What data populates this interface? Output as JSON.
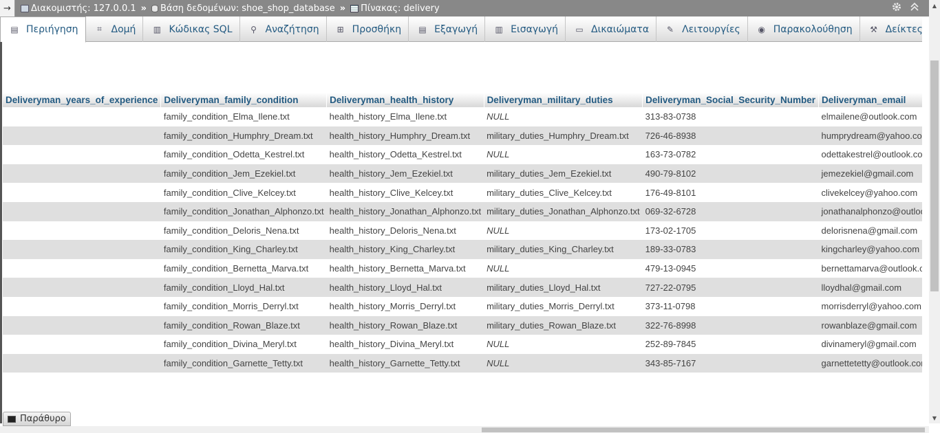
{
  "breadcrumb": {
    "back_glyph": "→",
    "server_label": "Διακομιστής: 127.0.0.1",
    "db_label": "Βάση δεδομένων: shoe_shop_database",
    "table_label": "Πίνακας: delivery",
    "separator": "»"
  },
  "tabs": [
    {
      "label": "Περιήγηση",
      "icon": "browse-icon",
      "glyph": "▤"
    },
    {
      "label": "Δομή",
      "icon": "structure-icon",
      "glyph": "⌗"
    },
    {
      "label": "Κώδικας SQL",
      "icon": "sql-icon",
      "glyph": "▥"
    },
    {
      "label": "Αναζήτηση",
      "icon": "search-icon",
      "glyph": "⚲"
    },
    {
      "label": "Προσθήκη",
      "icon": "insert-icon",
      "glyph": "⊞"
    },
    {
      "label": "Εξαγωγή",
      "icon": "export-icon",
      "glyph": "▤"
    },
    {
      "label": "Εισαγωγή",
      "icon": "import-icon",
      "glyph": "▥"
    },
    {
      "label": "Δικαιώματα",
      "icon": "privileges-icon",
      "glyph": "▭"
    },
    {
      "label": "Λειτουργίες",
      "icon": "operations-icon",
      "glyph": "✎"
    },
    {
      "label": "Παρακολούθηση",
      "icon": "tracking-icon",
      "glyph": "◉"
    },
    {
      "label": "Δείκτες",
      "icon": "triggers-icon",
      "glyph": "⚒"
    }
  ],
  "table": {
    "columns": [
      "Deliveryman_years_of_experience",
      "Deliveryman_family_condition",
      "Deliveryman_health_history",
      "Deliveryman_military_duties",
      "Deliveryman_Social_Security_Number",
      "Deliveryman_email"
    ],
    "rows": [
      [
        "",
        "family_condition_Elma_Ilene.txt",
        "health_history_Elma_Ilene.txt",
        "NULL",
        "313-83-0738",
        "elmailene@outlook.com"
      ],
      [
        "",
        "family_condition_Humphry_Dream.txt",
        "health_history_Humphry_Dream.txt",
        "military_duties_Humphry_Dream.txt",
        "726-46-8938",
        "humprydream@yahoo.com"
      ],
      [
        "",
        "family_condition_Odetta_Kestrel.txt",
        "health_history_Odetta_Kestrel.txt",
        "NULL",
        "163-73-0782",
        "odettakestrel@outlook.com"
      ],
      [
        "",
        "family_condition_Jem_Ezekiel.txt",
        "health_history_Jem_Ezekiel.txt",
        "military_duties_Jem_Ezekiel.txt",
        "490-79-8102",
        "jemezekiel@gmail.com"
      ],
      [
        "",
        "family_condition_Clive_Kelcey.txt",
        "health_history_Clive_Kelcey.txt",
        "military_duties_Clive_Kelcey.txt",
        "176-49-8101",
        "clivekelcey@yahoo.com"
      ],
      [
        "",
        "family_condition_Jonathan_Alphonzo.txt",
        "health_history_Jonathan_Alphonzo.txt",
        "military_duties_Jonathan_Alphonzo.txt",
        "069-32-6728",
        "jonathanalphonzo@outloook.com"
      ],
      [
        "",
        "family_condition_Deloris_Nena.txt",
        "health_history_Deloris_Nena.txt",
        "NULL",
        "173-02-1705",
        "delorisnena@gmail.com"
      ],
      [
        "",
        "family_condition_King_Charley.txt",
        "health_history_King_Charley.txt",
        "military_duties_King_Charley.txt",
        "189-33-0783",
        "kingcharley@yahoo.com"
      ],
      [
        "",
        "family_condition_Bernetta_Marva.txt",
        "health_history_Bernetta_Marva.txt",
        "NULL",
        "479-13-0945",
        "bernettamarva@outlook.com"
      ],
      [
        "",
        "family_condition_Lloyd_Hal.txt",
        "health_history_Lloyd_Hal.txt",
        "military_duties_Lloyd_Hal.txt",
        "727-22-0795",
        "lloydhal@gmail.com"
      ],
      [
        "",
        "family_condition_Morris_Derryl.txt",
        "health_history_Morris_Derryl.txt",
        "military_duties_Morris_Derryl.txt",
        "373-11-0798",
        "morrisderryl@yahoo.com"
      ],
      [
        "",
        "family_condition_Rowan_Blaze.txt",
        "health_history_Rowan_Blaze.txt",
        "military_duties_Rowan_Blaze.txt",
        "322-76-8998",
        "rowanblaze@gmail.com"
      ],
      [
        "",
        "family_condition_Divina_Meryl.txt",
        "health_history_Divina_Meryl.txt",
        "NULL",
        "252-89-7845",
        "divinameryl@gmail.com"
      ],
      [
        "",
        "family_condition_Garnette_Tetty.txt",
        "health_history_Garnette_Tetty.txt",
        "NULL",
        "343-85-7167",
        "garnettetetty@outlook.com"
      ]
    ]
  },
  "console": {
    "label": "Παράθυρο"
  },
  "colors": {
    "link": "#235a81",
    "row_even": "#dfdfdf",
    "topbar": "#888888"
  }
}
